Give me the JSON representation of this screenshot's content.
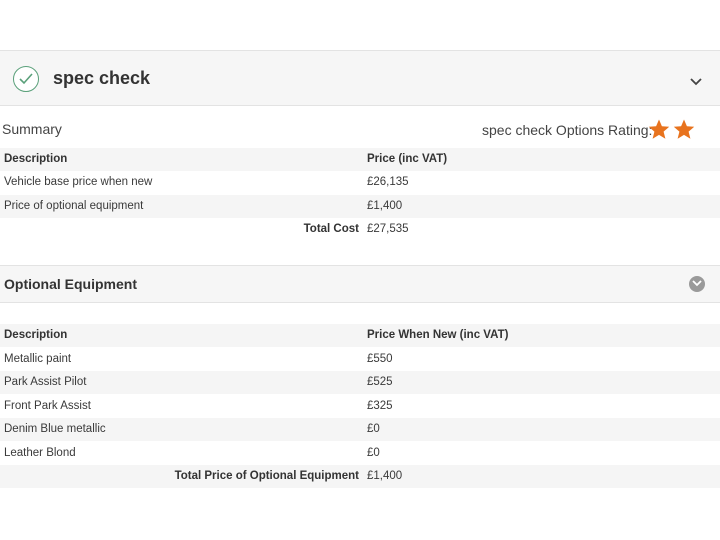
{
  "spec_check": {
    "title": "spec check",
    "check_icon": "check-circle-icon",
    "collapse_icon": "chevron-down-icon",
    "accent_color": "#5aa07a"
  },
  "summary": {
    "label": "Summary",
    "rating_label": "spec check Options Rating:",
    "rating_stars": 2,
    "star_color": "#e8731e",
    "columns": [
      "Description",
      "Price (inc VAT)"
    ],
    "rows": [
      {
        "description": "Vehicle base price when new",
        "price": "£26,135"
      },
      {
        "description": "Price of optional equipment",
        "price": "£1,400"
      }
    ],
    "total_label": "Total Cost",
    "total_value": "£27,535"
  },
  "optional_equipment": {
    "title": "Optional Equipment",
    "toggle_icon": "chevron-circle-down-icon",
    "columns": [
      "Description",
      "Price When New (inc VAT)"
    ],
    "rows": [
      {
        "description": "Metallic paint",
        "price": "£550"
      },
      {
        "description": "Park Assist Pilot",
        "price": "£525"
      },
      {
        "description": "Front Park Assist",
        "price": "£325"
      },
      {
        "description": "Denim Blue metallic",
        "price": "£0"
      },
      {
        "description": "Leather Blond",
        "price": "£0"
      }
    ],
    "total_label": "Total Price of Optional Equipment",
    "total_value": "£1,400"
  }
}
